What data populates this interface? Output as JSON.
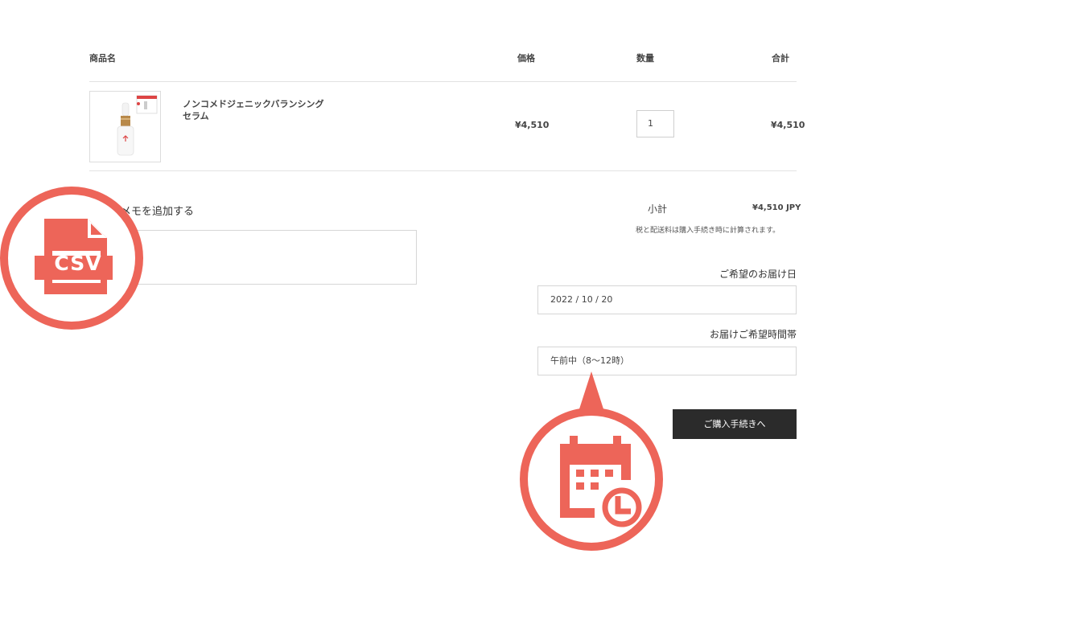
{
  "table": {
    "headers": {
      "product": "商品名",
      "price": "価格",
      "quantity": "数量",
      "total": "合計"
    },
    "items": [
      {
        "name_line1": "ノンコメドジェニックバランシング",
        "name_line2": "セラム",
        "price": "¥4,510",
        "quantity": "1",
        "total": "¥4,510"
      }
    ]
  },
  "memo": {
    "label": "メモを追加する"
  },
  "summary": {
    "subtotal_label": "小計",
    "subtotal_value": "¥4,510 JPY",
    "tax_note": "税と配送料は購入手続き時に計算されます。"
  },
  "delivery": {
    "date_label": "ご希望のお届け日",
    "date_value": "2022 / 10 / 20",
    "time_label": "お届けご希望時間帯",
    "time_value": "午前中（8〜12時）"
  },
  "checkout_label": "ご購入手続きへ",
  "badges": {
    "csv_text": "CSV",
    "csv_icon": "csv-file-icon",
    "calendar_icon": "calendar-clock-icon",
    "accent_color": "#ed6559"
  }
}
